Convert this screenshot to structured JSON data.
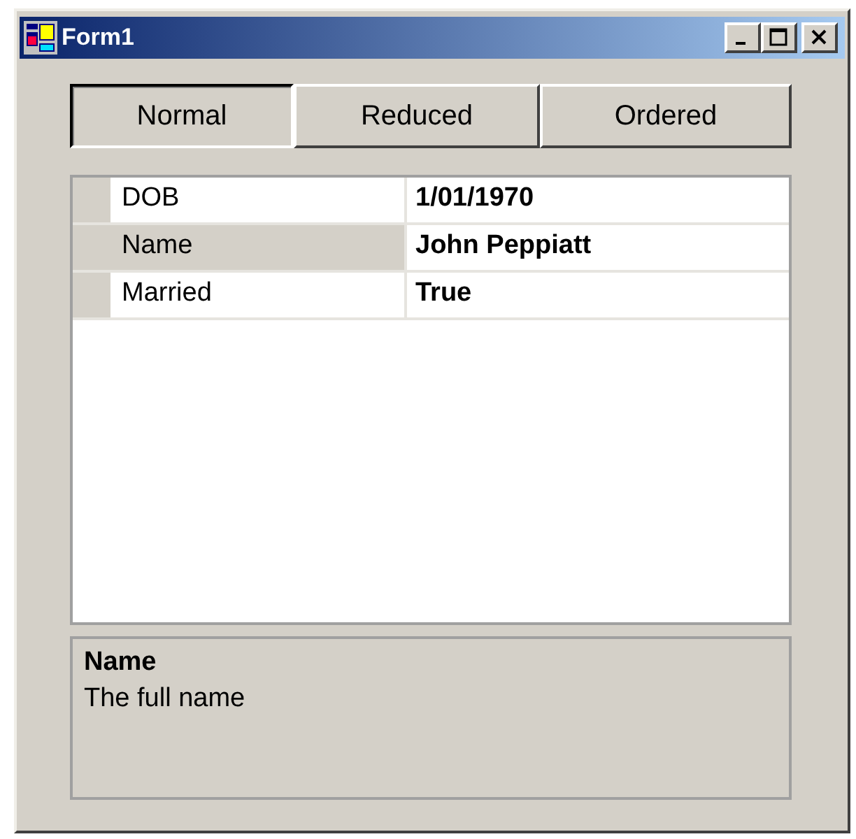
{
  "window": {
    "title": "Form1"
  },
  "buttons": [
    {
      "label": "Normal",
      "selected": true
    },
    {
      "label": "Reduced",
      "selected": false
    },
    {
      "label": "Ordered",
      "selected": false
    }
  ],
  "properties": [
    {
      "name": "DOB",
      "value": "1/01/1970",
      "selected": false
    },
    {
      "name": "Name",
      "value": "John Peppiatt",
      "selected": true
    },
    {
      "name": "Married",
      "value": "True",
      "selected": false
    }
  ],
  "description": {
    "title": "Name",
    "text": "The full name"
  }
}
